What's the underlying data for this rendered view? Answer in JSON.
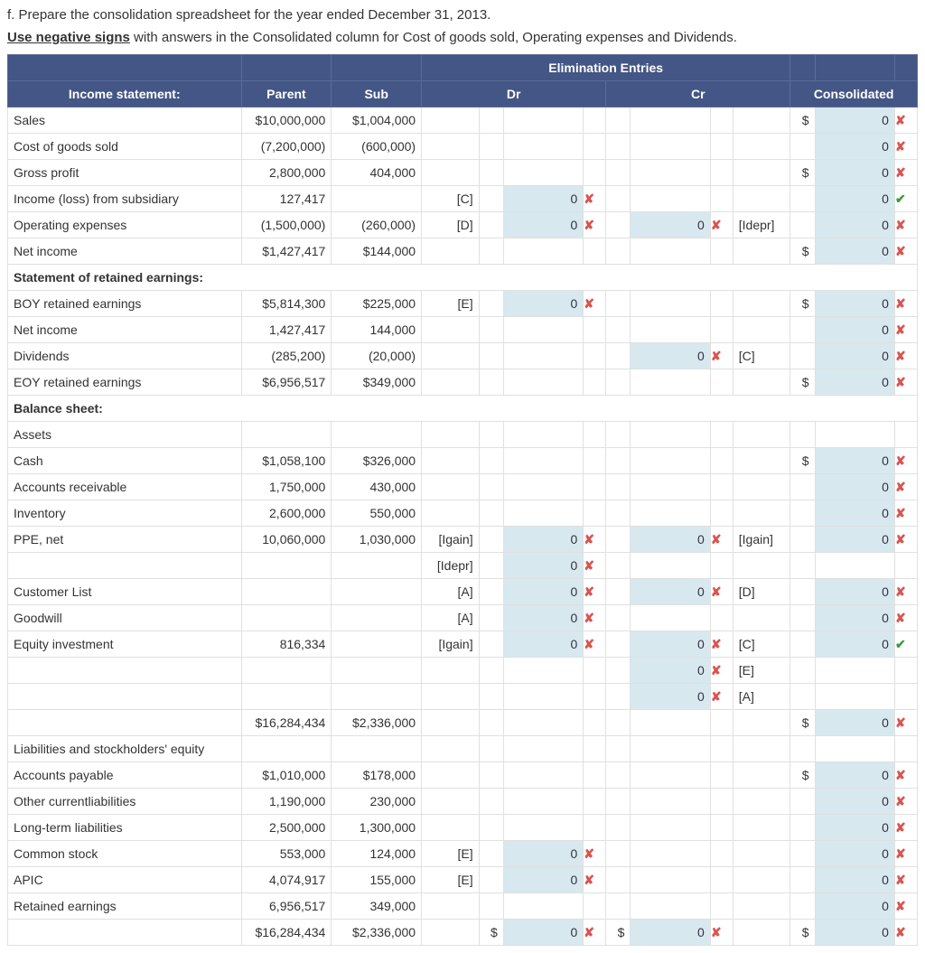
{
  "instruction_part": "f. Prepare the consolidation spreadsheet for the year ended December 31, 2013.",
  "instruction_note_prefix": "Use negative signs",
  "instruction_note": " with answers in the Consolidated column for Cost of goods sold, Operating expenses and Dividends.",
  "header": {
    "income_statement": "Income statement:",
    "parent": "Parent",
    "sub": "Sub",
    "elim": "Elimination Entries",
    "dr": "Dr",
    "cr": "Cr",
    "consolidated": "Consolidated"
  },
  "marks": {
    "wrong": "✘",
    "right": "✔"
  },
  "sym": {
    "dollar": "$"
  },
  "rows": [
    {
      "label": "Sales",
      "parent": "$10,000,000",
      "sub": "$1,004,000",
      "dr_tag": "",
      "dr_sym": "",
      "dr_val": "",
      "dr_mark": "",
      "cr_val": "",
      "cr_mark": "",
      "cr_tag": "",
      "con_sym": "$",
      "con_val": "0",
      "con_mark": "wrong"
    },
    {
      "label": "Cost of goods sold",
      "parent": "(7,200,000)",
      "sub": "(600,000)",
      "dr_tag": "",
      "dr_sym": "",
      "dr_val": "",
      "dr_mark": "",
      "cr_val": "",
      "cr_mark": "",
      "cr_tag": "",
      "con_sym": "",
      "con_val": "0",
      "con_mark": "wrong"
    },
    {
      "label": "Gross profit",
      "parent": "2,800,000",
      "sub": "404,000",
      "dr_tag": "",
      "dr_sym": "",
      "dr_val": "",
      "dr_mark": "",
      "cr_val": "",
      "cr_mark": "",
      "cr_tag": "",
      "con_sym": "$",
      "con_val": "0",
      "con_mark": "wrong"
    },
    {
      "label": "Income (loss) from subsidiary",
      "parent": "127,417",
      "sub": "",
      "dr_tag": "[C]",
      "dr_sym": "",
      "dr_val": "0",
      "dr_mark": "wrong",
      "cr_val": "",
      "cr_mark": "",
      "cr_tag": "",
      "con_sym": "",
      "con_val": "0",
      "con_mark": "right"
    },
    {
      "label": "Operating expenses",
      "parent": "(1,500,000)",
      "sub": "(260,000)",
      "dr_tag": "[D]",
      "dr_sym": "",
      "dr_val": "0",
      "dr_mark": "wrong",
      "cr_val": "0",
      "cr_mark": "wrong",
      "cr_tag": "[Idepr]",
      "con_sym": "",
      "con_val": "0",
      "con_mark": "wrong"
    },
    {
      "label": "Net income",
      "parent": "$1,427,417",
      "sub": "$144,000",
      "dr_tag": "",
      "dr_sym": "",
      "dr_val": "",
      "dr_mark": "",
      "cr_val": "",
      "cr_mark": "",
      "cr_tag": "",
      "con_sym": "$",
      "con_val": "0",
      "con_mark": "wrong"
    },
    {
      "section": "Statement of retained earnings:"
    },
    {
      "label": "BOY retained earnings",
      "parent": "$5,814,300",
      "sub": "$225,000",
      "dr_tag": "[E]",
      "dr_sym": "",
      "dr_val": "0",
      "dr_mark": "wrong",
      "cr_val": "",
      "cr_mark": "",
      "cr_tag": "",
      "con_sym": "$",
      "con_val": "0",
      "con_mark": "wrong"
    },
    {
      "label": "Net income",
      "parent": "1,427,417",
      "sub": "144,000",
      "dr_tag": "",
      "dr_sym": "",
      "dr_val": "",
      "dr_mark": "",
      "cr_val": "",
      "cr_mark": "",
      "cr_tag": "",
      "con_sym": "",
      "con_val": "0",
      "con_mark": "wrong"
    },
    {
      "label": "Dividends",
      "parent": "(285,200)",
      "sub": "(20,000)",
      "dr_tag": "",
      "dr_sym": "",
      "dr_val": "",
      "dr_mark": "",
      "cr_val": "0",
      "cr_mark": "wrong",
      "cr_tag": "[C]",
      "con_sym": "",
      "con_val": "0",
      "con_mark": "wrong"
    },
    {
      "label": "EOY retained earnings",
      "parent": "$6,956,517",
      "sub": "$349,000",
      "dr_tag": "",
      "dr_sym": "",
      "dr_val": "",
      "dr_mark": "",
      "cr_val": "",
      "cr_mark": "",
      "cr_tag": "",
      "con_sym": "$",
      "con_val": "0",
      "con_mark": "wrong"
    },
    {
      "section": "Balance sheet:"
    },
    {
      "label": "Assets",
      "plain": true
    },
    {
      "label": "Cash",
      "parent": "$1,058,100",
      "sub": "$326,000",
      "dr_tag": "",
      "dr_sym": "",
      "dr_val": "",
      "dr_mark": "",
      "cr_val": "",
      "cr_mark": "",
      "cr_tag": "",
      "con_sym": "$",
      "con_val": "0",
      "con_mark": "wrong"
    },
    {
      "label": "Accounts receivable",
      "parent": "1,750,000",
      "sub": "430,000",
      "dr_tag": "",
      "dr_sym": "",
      "dr_val": "",
      "dr_mark": "",
      "cr_val": "",
      "cr_mark": "",
      "cr_tag": "",
      "con_sym": "",
      "con_val": "0",
      "con_mark": "wrong"
    },
    {
      "label": "Inventory",
      "parent": "2,600,000",
      "sub": "550,000",
      "dr_tag": "",
      "dr_sym": "",
      "dr_val": "",
      "dr_mark": "",
      "cr_val": "",
      "cr_mark": "",
      "cr_tag": "",
      "con_sym": "",
      "con_val": "0",
      "con_mark": "wrong"
    },
    {
      "label": "PPE, net",
      "parent": "10,060,000",
      "sub": "1,030,000",
      "dr_tag": "[Igain]",
      "dr_sym": "",
      "dr_val": "0",
      "dr_mark": "wrong",
      "cr_val": "0",
      "cr_mark": "wrong",
      "cr_tag": "[Igain]",
      "con_sym": "",
      "con_val": "0",
      "con_mark": "wrong"
    },
    {
      "label": "",
      "parent": "",
      "sub": "",
      "dr_tag": "[Idepr]",
      "dr_sym": "",
      "dr_val": "0",
      "dr_mark": "wrong",
      "cr_val": "",
      "cr_mark": "",
      "cr_tag": "",
      "con_sym": "",
      "con_val": "",
      "con_mark": ""
    },
    {
      "label": "Customer List",
      "parent": "",
      "sub": "",
      "dr_tag": "[A]",
      "dr_sym": "",
      "dr_val": "0",
      "dr_mark": "wrong",
      "cr_val": "0",
      "cr_mark": "wrong",
      "cr_tag": "[D]",
      "con_sym": "",
      "con_val": "0",
      "con_mark": "wrong"
    },
    {
      "label": "Goodwill",
      "parent": "",
      "sub": "",
      "dr_tag": "[A]",
      "dr_sym": "",
      "dr_val": "0",
      "dr_mark": "wrong",
      "cr_val": "",
      "cr_mark": "",
      "cr_tag": "",
      "con_sym": "",
      "con_val": "0",
      "con_mark": "wrong"
    },
    {
      "label": "Equity investment",
      "parent": "816,334",
      "sub": "",
      "dr_tag": "[Igain]",
      "dr_sym": "",
      "dr_val": "0",
      "dr_mark": "wrong",
      "cr_val": "0",
      "cr_mark": "wrong",
      "cr_tag": "[C]",
      "con_sym": "",
      "con_val": "0",
      "con_mark": "right"
    },
    {
      "label": "",
      "parent": "",
      "sub": "",
      "dr_tag": "",
      "dr_sym": "",
      "dr_val": "",
      "dr_mark": "",
      "cr_val": "0",
      "cr_mark": "wrong",
      "cr_tag": "[E]",
      "con_sym": "",
      "con_val": "",
      "con_mark": ""
    },
    {
      "label": "",
      "parent": "",
      "sub": "",
      "dr_tag": "",
      "dr_sym": "",
      "dr_val": "",
      "dr_mark": "",
      "cr_val": "0",
      "cr_mark": "wrong",
      "cr_tag": "[A]",
      "con_sym": "",
      "con_val": "",
      "con_mark": ""
    },
    {
      "label": "",
      "parent": "$16,284,434",
      "sub": "$2,336,000",
      "dr_tag": "",
      "dr_sym": "",
      "dr_val": "",
      "dr_mark": "",
      "cr_val": "",
      "cr_mark": "",
      "cr_tag": "",
      "con_sym": "$",
      "con_val": "0",
      "con_mark": "wrong"
    },
    {
      "label": "Liabilities and stockholders' equity",
      "plain": true
    },
    {
      "label": "Accounts payable",
      "parent": "$1,010,000",
      "sub": "$178,000",
      "dr_tag": "",
      "dr_sym": "",
      "dr_val": "",
      "dr_mark": "",
      "cr_val": "",
      "cr_mark": "",
      "cr_tag": "",
      "con_sym": "$",
      "con_val": "0",
      "con_mark": "wrong"
    },
    {
      "label": "Other currentliabilities",
      "parent": "1,190,000",
      "sub": "230,000",
      "dr_tag": "",
      "dr_sym": "",
      "dr_val": "",
      "dr_mark": "",
      "cr_val": "",
      "cr_mark": "",
      "cr_tag": "",
      "con_sym": "",
      "con_val": "0",
      "con_mark": "wrong"
    },
    {
      "label": "Long-term liabilities",
      "parent": "2,500,000",
      "sub": "1,300,000",
      "dr_tag": "",
      "dr_sym": "",
      "dr_val": "",
      "dr_mark": "",
      "cr_val": "",
      "cr_mark": "",
      "cr_tag": "",
      "con_sym": "",
      "con_val": "0",
      "con_mark": "wrong"
    },
    {
      "label": "Common stock",
      "parent": "553,000",
      "sub": "124,000",
      "dr_tag": "[E]",
      "dr_sym": "",
      "dr_val": "0",
      "dr_mark": "wrong",
      "cr_val": "",
      "cr_mark": "",
      "cr_tag": "",
      "con_sym": "",
      "con_val": "0",
      "con_mark": "wrong"
    },
    {
      "label": "APIC",
      "parent": "4,074,917",
      "sub": "155,000",
      "dr_tag": "[E]",
      "dr_sym": "",
      "dr_val": "0",
      "dr_mark": "wrong",
      "cr_val": "",
      "cr_mark": "",
      "cr_tag": "",
      "con_sym": "",
      "con_val": "0",
      "con_mark": "wrong"
    },
    {
      "label": "Retained earnings",
      "parent": "6,956,517",
      "sub": "349,000",
      "dr_tag": "",
      "dr_sym": "",
      "dr_val": "",
      "dr_mark": "",
      "cr_val": "",
      "cr_mark": "",
      "cr_tag": "",
      "con_sym": "",
      "con_val": "0",
      "con_mark": "wrong"
    },
    {
      "label": "",
      "parent": "$16,284,434",
      "sub": "$2,336,000",
      "dr_tag": "",
      "dr_sym": "$",
      "dr_val": "0",
      "dr_mark": "wrong",
      "cr_sym": "$",
      "cr_val": "0",
      "cr_mark": "wrong",
      "cr_tag": "",
      "con_sym": "$",
      "con_val": "0",
      "con_mark": "wrong",
      "totals": true
    }
  ]
}
